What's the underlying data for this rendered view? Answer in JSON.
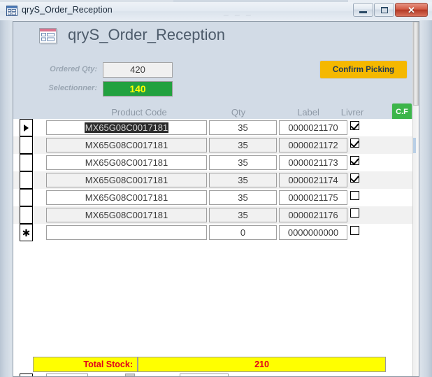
{
  "window": {
    "title": "qryS_Order_Reception",
    "icon": "access-form-icon",
    "ghost_text": "_ _ _",
    "controls": {
      "minimize": "–",
      "restore": "❐",
      "close": "✕"
    }
  },
  "form": {
    "header": {
      "icon": "access-form-icon-pink",
      "title": "qryS_Order_Reception",
      "fields": [
        {
          "label": "Ordered Qty:",
          "value": "420"
        },
        {
          "label": "Selectionner:",
          "value": "140"
        }
      ],
      "confirm_button": "Confirm Picking",
      "cf_button": "C.F"
    },
    "columns": {
      "product_code": "Product Code",
      "qty": "Qty",
      "label": "Label",
      "livrer": "Livrer"
    },
    "rows": [
      {
        "selector": "current",
        "product_code": "MX65G08C0017181",
        "qty": "35",
        "label": "0000021170",
        "livrer": true,
        "selected": true
      },
      {
        "selector": "",
        "product_code": "MX65G08C0017181",
        "qty": "35",
        "label": "0000021172",
        "livrer": true,
        "selected": false
      },
      {
        "selector": "",
        "product_code": "MX65G08C0017181",
        "qty": "35",
        "label": "0000021173",
        "livrer": true,
        "selected": false
      },
      {
        "selector": "",
        "product_code": "MX65G08C0017181",
        "qty": "35",
        "label": "0000021174",
        "livrer": true,
        "selected": false
      },
      {
        "selector": "",
        "product_code": "MX65G08C0017181",
        "qty": "35",
        "label": "0000021175",
        "livrer": false,
        "selected": false
      },
      {
        "selector": "",
        "product_code": "MX65G08C0017181",
        "qty": "35",
        "label": "0000021176",
        "livrer": false,
        "selected": false
      },
      {
        "selector": "new",
        "product_code": "",
        "qty": "0",
        "label": "0000000000",
        "livrer": false,
        "selected": false
      }
    ],
    "footer": {
      "total_label": "Total Stock:",
      "total_value": "210"
    }
  },
  "colors": {
    "header_band": "#d2dbe6",
    "confirm_button": "#f5b800",
    "cf_button": "#3cb54a",
    "selectionner_bg": "#22a13f",
    "selectionner_fg": "#ffff00",
    "footer_bg": "#ffff00",
    "footer_fg": "#e0001b",
    "close_button": "#b33a26"
  }
}
